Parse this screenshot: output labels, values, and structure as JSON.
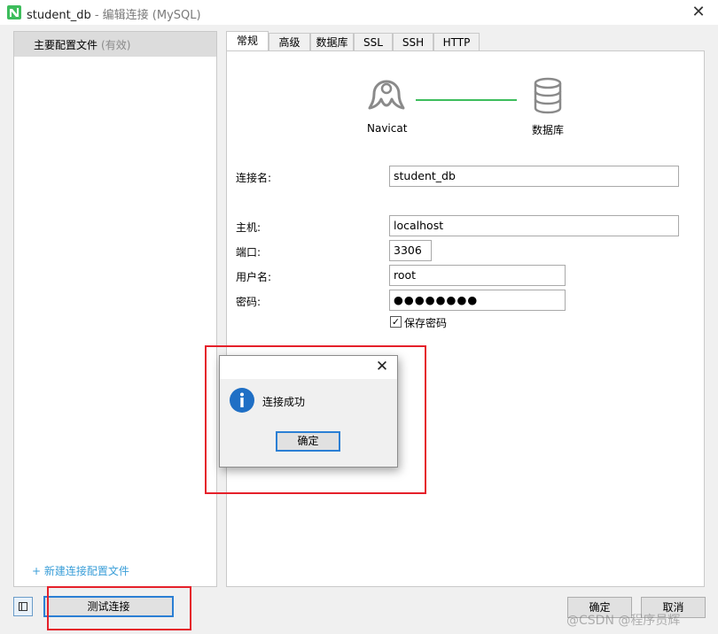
{
  "window": {
    "title": "student_db",
    "title_suffix": " - 编辑连接 (MySQL)",
    "close_glyph": "✕"
  },
  "sidebar": {
    "profile_label": "主要配置文件",
    "profile_status": "(有效)",
    "new_profile_link": "+ 新建连接配置文件"
  },
  "tabs": [
    {
      "label": "常规",
      "active": true
    },
    {
      "label": "高级"
    },
    {
      "label": "数据库"
    },
    {
      "label": "SSL"
    },
    {
      "label": "SSH"
    },
    {
      "label": "HTTP"
    }
  ],
  "diagram": {
    "navicat_label": "Navicat",
    "db_label": "数据库",
    "line_color": "#3dbd5c"
  },
  "form": {
    "connection_name": {
      "label": "连接名:",
      "value": "student_db"
    },
    "host": {
      "label": "主机:",
      "value": "localhost"
    },
    "port": {
      "label": "端口:",
      "value": "3306"
    },
    "username": {
      "label": "用户名:",
      "value": "root"
    },
    "password": {
      "label": "密码:",
      "value": "●●●●●●●●"
    },
    "save_password": {
      "label": "保存密码",
      "checked": true,
      "check_glyph": "✓"
    }
  },
  "modal": {
    "message": "连接成功",
    "ok_label": "确定",
    "close_glyph": "✕"
  },
  "footer": {
    "test_button": "测试连接",
    "ok_button": "确定",
    "cancel_button": "取消"
  },
  "watermark": "@CSDN @程序员辉",
  "colors": {
    "accent": "#2b7fd4",
    "highlight": "#e5202a",
    "link": "#3a9ed8"
  }
}
